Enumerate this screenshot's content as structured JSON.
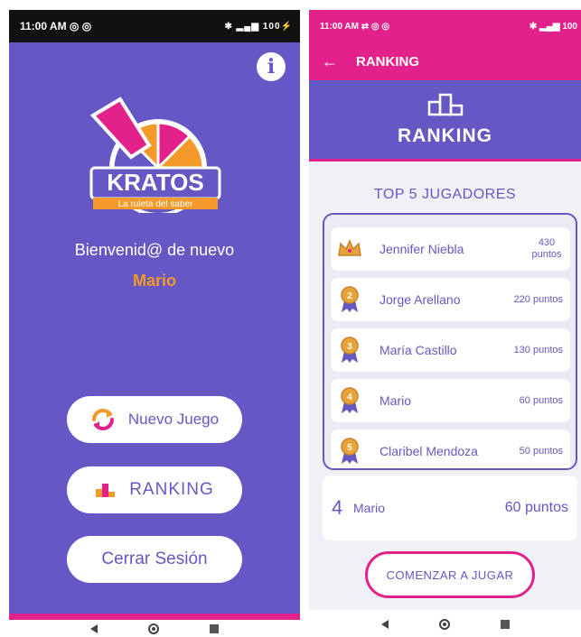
{
  "left_screen": {
    "status_time": "11:00 AM",
    "status_right": "100",
    "logo_title": "KRATOS",
    "logo_subtitle": "La ruleta del saber",
    "welcome_text": "Bienvenid@ de nuevo",
    "username": "Mario",
    "buttons": {
      "nuevo_juego": "Nuevo Juego",
      "ranking": "RANKING",
      "cerrar_sesion": "Cerrar Sesión"
    },
    "icons": {
      "info": "info-icon",
      "refresh": "refresh-icon",
      "podium": "podium-icon"
    }
  },
  "right_screen": {
    "status_time": "11:00 AM",
    "status_right": "100",
    "appbar_title": "RANKING",
    "header_title": "RANKING",
    "top5_title": "TOP 5 JUGADORES",
    "players": [
      {
        "name": "Jennifer Niebla",
        "points": "430 puntos",
        "medal": "crown"
      },
      {
        "name": "Jorge Arellano",
        "points": "220 puntos",
        "medal": "2"
      },
      {
        "name": "María Castillo",
        "points": "130 puntos",
        "medal": "3"
      },
      {
        "name": "Mario",
        "points": "60 puntos",
        "medal": "4"
      },
      {
        "name": "Claribel Mendoza",
        "points": "50 puntos",
        "medal": "5"
      }
    ],
    "current_player": {
      "position": "4",
      "name": "Mario",
      "points": "60 puntos"
    },
    "start_button": "COMENZAR A JUGAR"
  },
  "colors": {
    "purple": "#6658c4",
    "pink": "#e3218b",
    "orange": "#f39a2a",
    "gold": "#e8a43a"
  }
}
